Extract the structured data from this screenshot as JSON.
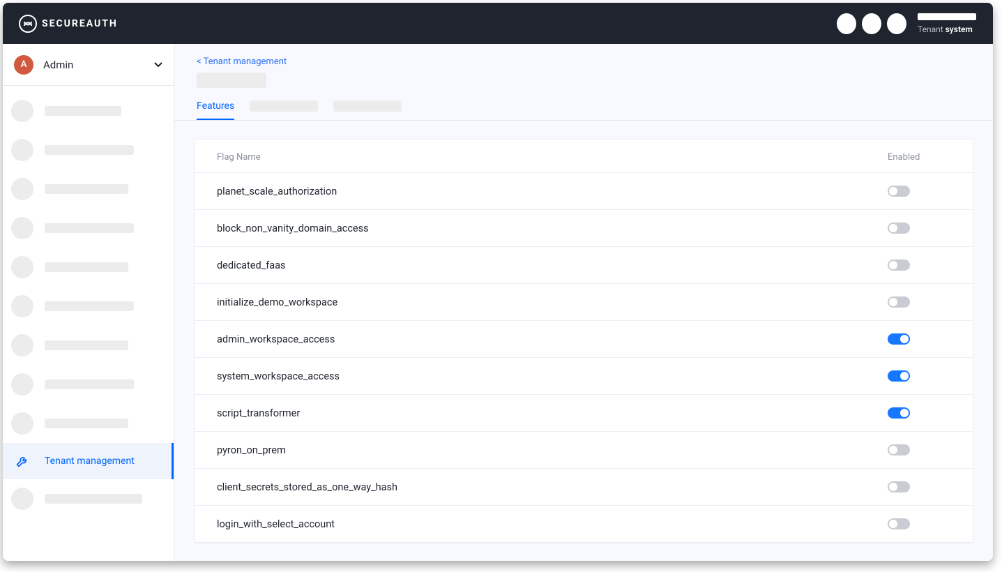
{
  "brand": {
    "name": "SECUREAUTH"
  },
  "header": {
    "tenant_label": "Tenant",
    "tenant_value": "system"
  },
  "sidebar": {
    "workspace_avatar": "A",
    "workspace_name": "Admin",
    "active_item_label": "Tenant management"
  },
  "main": {
    "breadcrumb": "< Tenant management",
    "active_tab": "Features",
    "table_headers": {
      "flag": "Flag Name",
      "enabled": "Enabled"
    },
    "flags": [
      {
        "name": "planet_scale_authorization",
        "enabled": false
      },
      {
        "name": "block_non_vanity_domain_access",
        "enabled": false
      },
      {
        "name": "dedicated_faas",
        "enabled": false
      },
      {
        "name": "initialize_demo_workspace",
        "enabled": false
      },
      {
        "name": "admin_workspace_access",
        "enabled": true
      },
      {
        "name": "system_workspace_access",
        "enabled": true
      },
      {
        "name": "script_transformer",
        "enabled": true
      },
      {
        "name": "pyron_on_prem",
        "enabled": false
      },
      {
        "name": "client_secrets_stored_as_one_way_hash",
        "enabled": false
      },
      {
        "name": "login_with_select_account",
        "enabled": false
      }
    ]
  }
}
